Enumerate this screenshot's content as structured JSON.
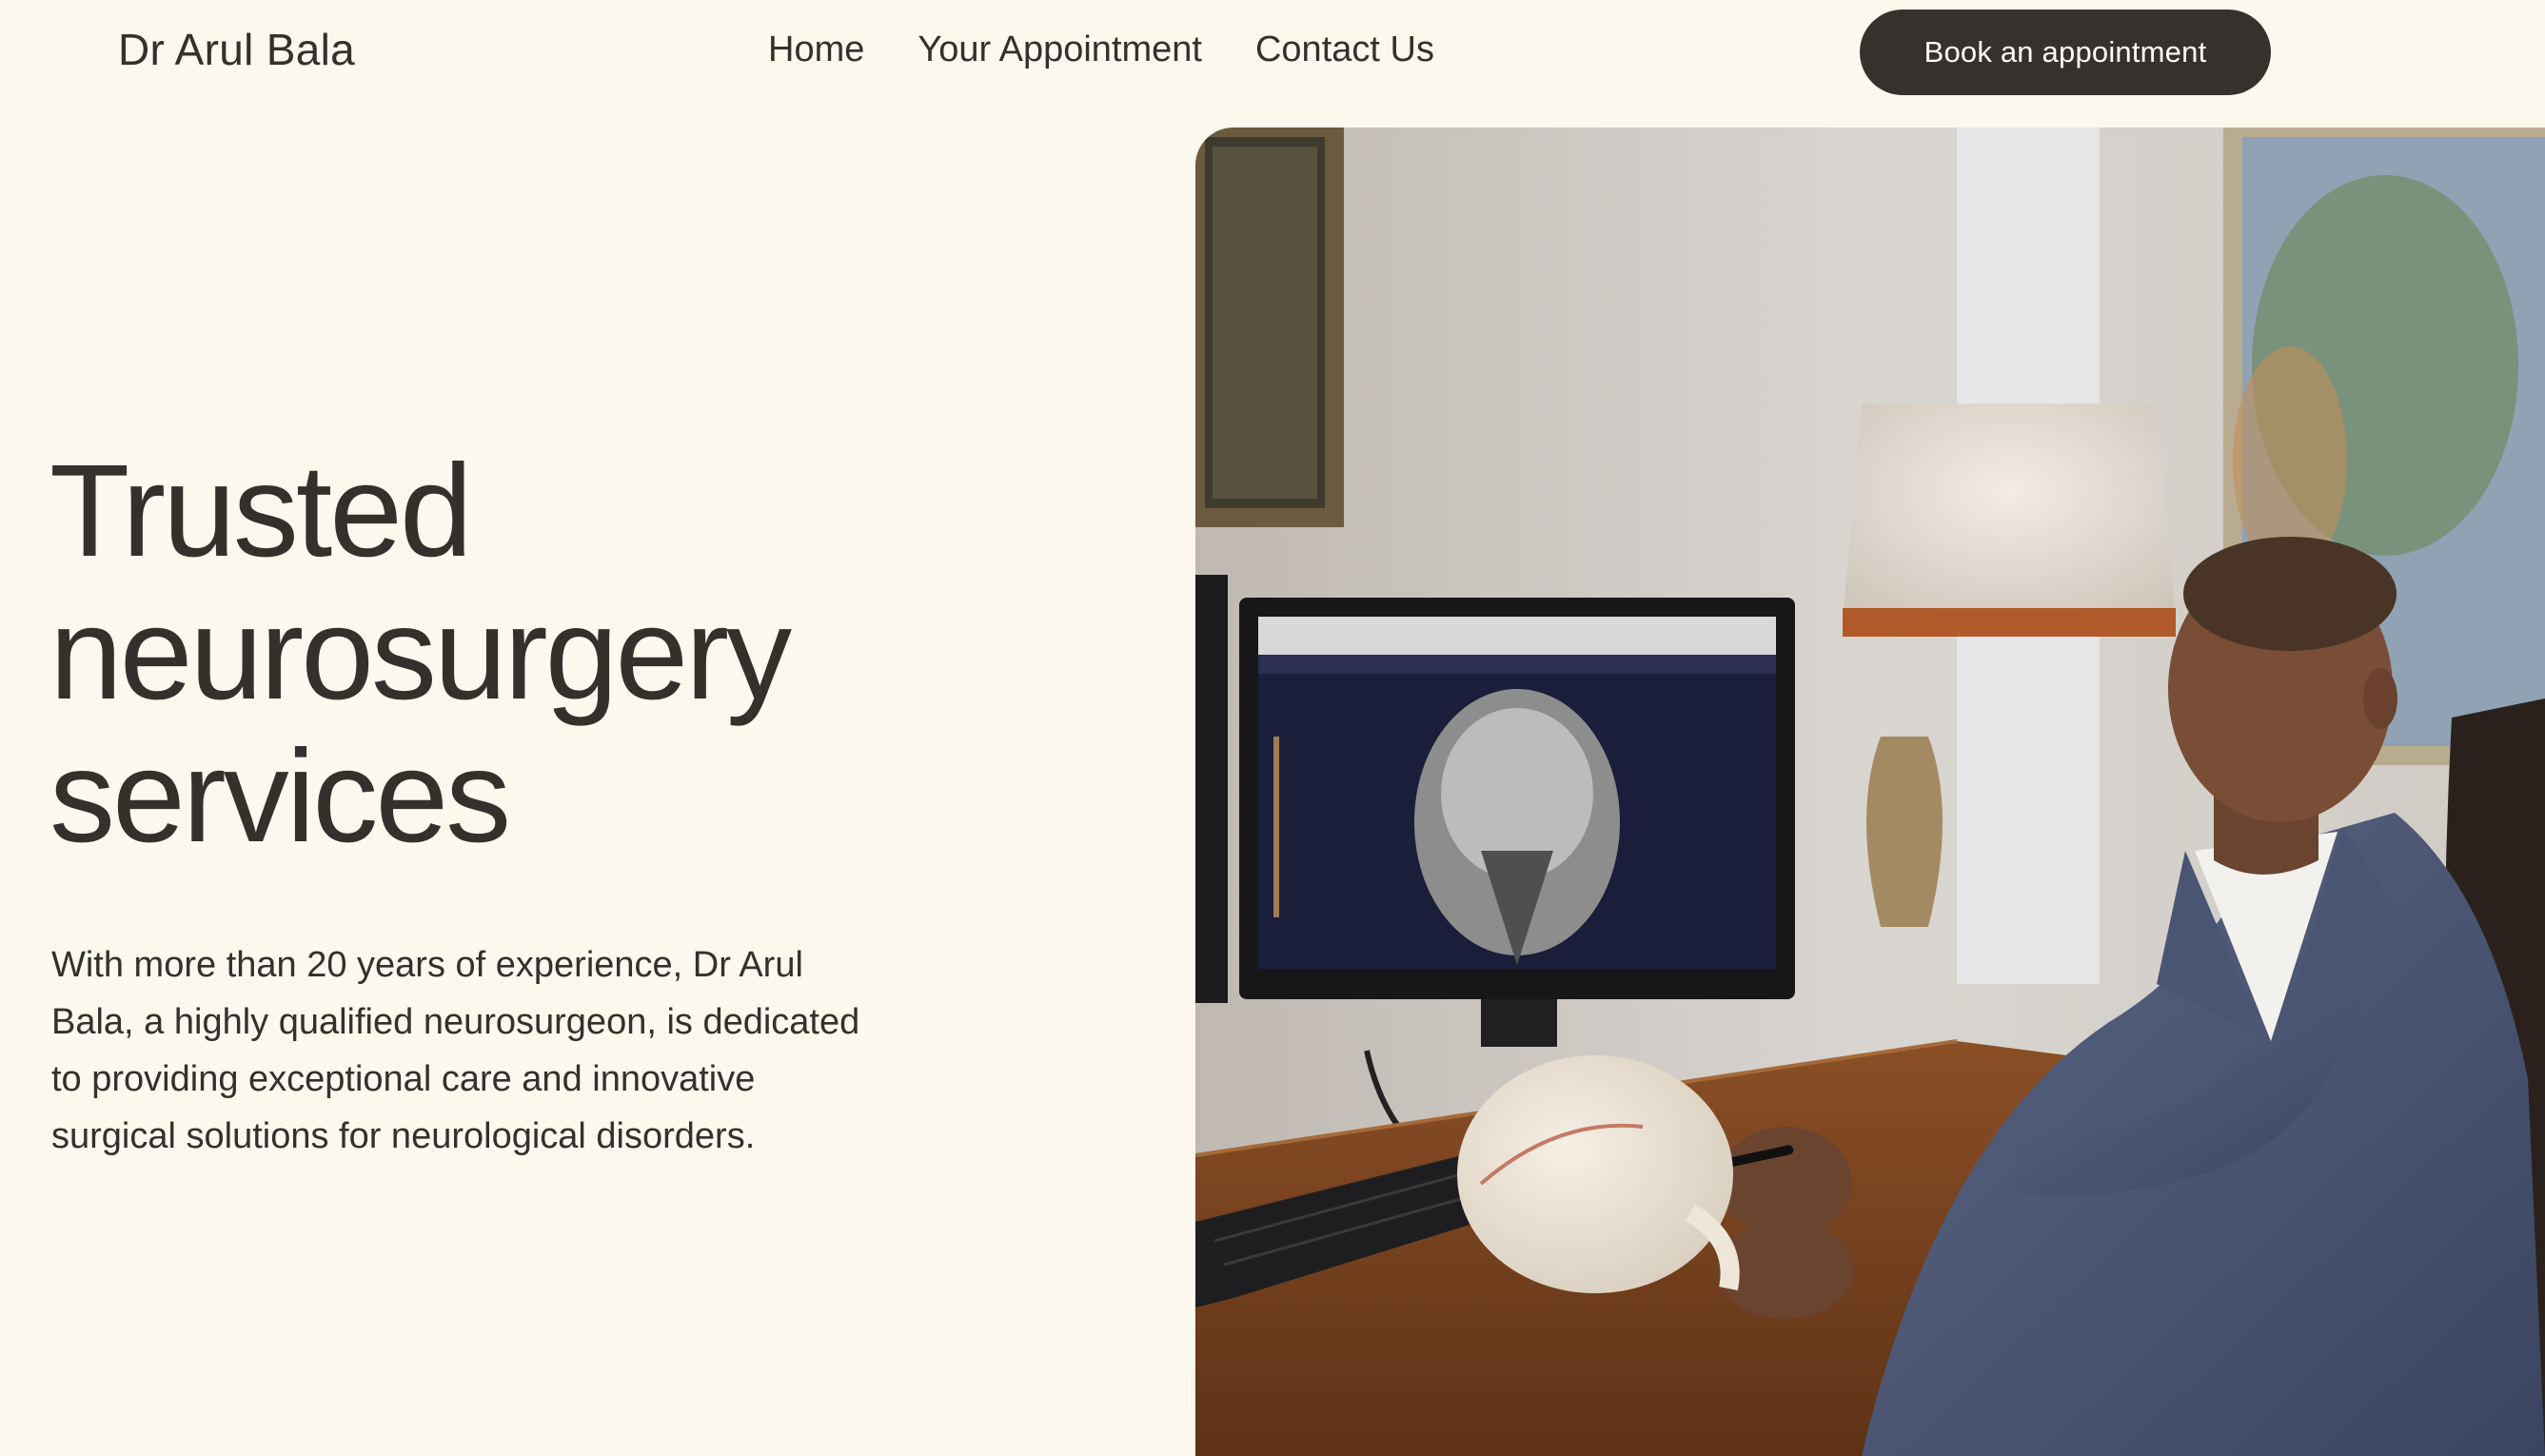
{
  "header": {
    "brand": "Dr Arul Bala",
    "nav": [
      {
        "label": "Home"
      },
      {
        "label": "Your Appointment"
      },
      {
        "label": "Contact Us"
      }
    ],
    "cta_label": "Book an appointment"
  },
  "hero": {
    "title_lines": [
      "Trusted",
      "neurosurgery",
      "services"
    ],
    "description": "With more than 20 years of experience, Dr Arul Bala, a highly qualified neurosurgeon, is dedicated to providing exceptional care and innovative surgical solutions for neurological disorders."
  },
  "colors": {
    "background": "#fcf8ee",
    "text": "#34302c",
    "button": "#37312d",
    "button_text": "#ffffff"
  }
}
